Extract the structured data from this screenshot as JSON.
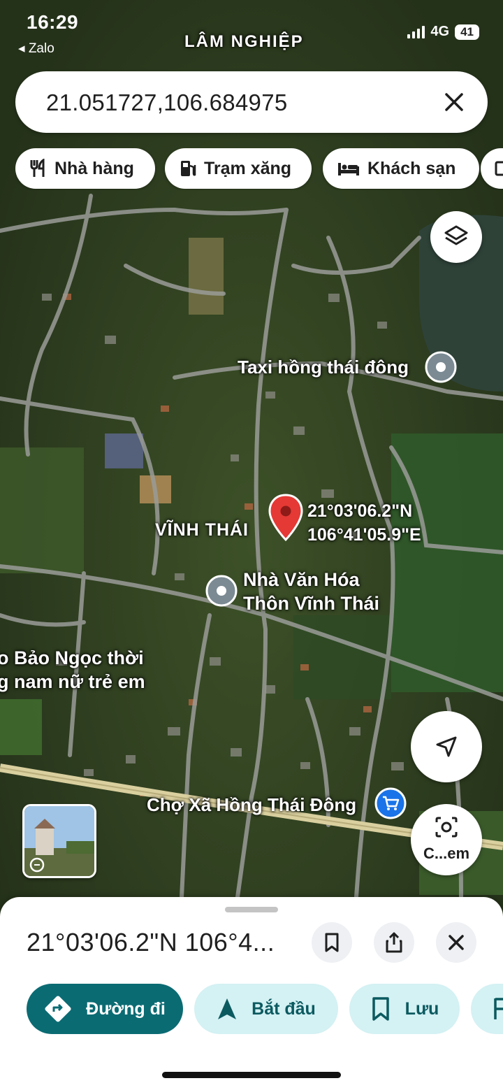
{
  "status_bar": {
    "time": "16:29",
    "back_app": "◂ Zalo",
    "network": "4G",
    "battery": "41"
  },
  "search": {
    "value": "21.051727,106.684975"
  },
  "chips": [
    {
      "icon": "restaurant-icon",
      "label": "Nhà hàng"
    },
    {
      "icon": "gas-station-icon",
      "label": "Trạm xăng"
    },
    {
      "icon": "hotel-icon",
      "label": "Khách sạn"
    }
  ],
  "map": {
    "area_label": "LÂM NGHIỆP",
    "village_label": "VĨNH THÁI",
    "pin_coords": [
      "21°03'06.2\"N",
      "106°41'05.9\"E"
    ],
    "places": {
      "taxi": "Taxi hồng thái đông",
      "culture_house": [
        "Nhà Văn Hóa",
        "Thôn Vĩnh Thái"
      ],
      "truncated_place": [
        "o Bảo Ngọc thời",
        "g nam nữ trẻ em"
      ],
      "market": "Chợ Xã Hồng Thái Đông"
    },
    "camera_label": "C...em"
  },
  "sheet": {
    "title": "21°03'06.2\"N 106°4...",
    "actions": [
      {
        "label": "Đường đi",
        "icon": "directions-icon"
      },
      {
        "label": "Bắt đầu",
        "icon": "navigation-arrow-icon"
      },
      {
        "label": "Lưu",
        "icon": "bookmark-icon"
      }
    ]
  },
  "colors": {
    "accent": "#0b6b73",
    "tonal": "#d4f1f3",
    "pin_red": "#e53935",
    "poi_gray": "#7b8a93",
    "shopping_blue": "#1a73e8"
  }
}
